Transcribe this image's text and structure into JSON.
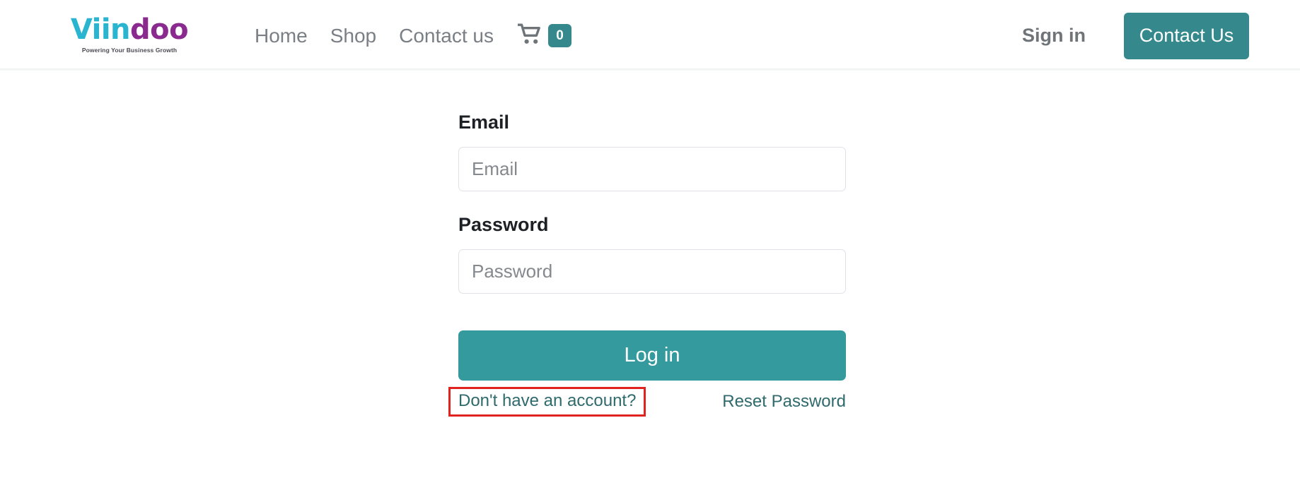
{
  "header": {
    "logo": {
      "name": "Viindoo",
      "word_part_1": "Viin",
      "word_part_2": "doo",
      "tagline": "Powering Your Business Growth",
      "color_primary": "#29b4cf",
      "color_secondary": "#8b2a8e"
    },
    "nav": [
      {
        "label": "Home"
      },
      {
        "label": "Shop"
      },
      {
        "label": "Contact us"
      }
    ],
    "cart": {
      "icon": "shopping-cart-icon",
      "count": "0",
      "badge_color": "#35898d"
    },
    "sign_in_label": "Sign in",
    "contact_button_label": "Contact Us",
    "accent_color": "#35898d"
  },
  "login": {
    "email": {
      "label": "Email",
      "placeholder": "Email",
      "value": ""
    },
    "password": {
      "label": "Password",
      "placeholder": "Password",
      "value": ""
    },
    "submit_label": "Log in",
    "submit_color": "#349a9e",
    "signup_link_label": "Don't have an account?",
    "reset_link_label": "Reset Password",
    "link_color": "#2f6a6d",
    "highlight_color": "#e0231f"
  }
}
